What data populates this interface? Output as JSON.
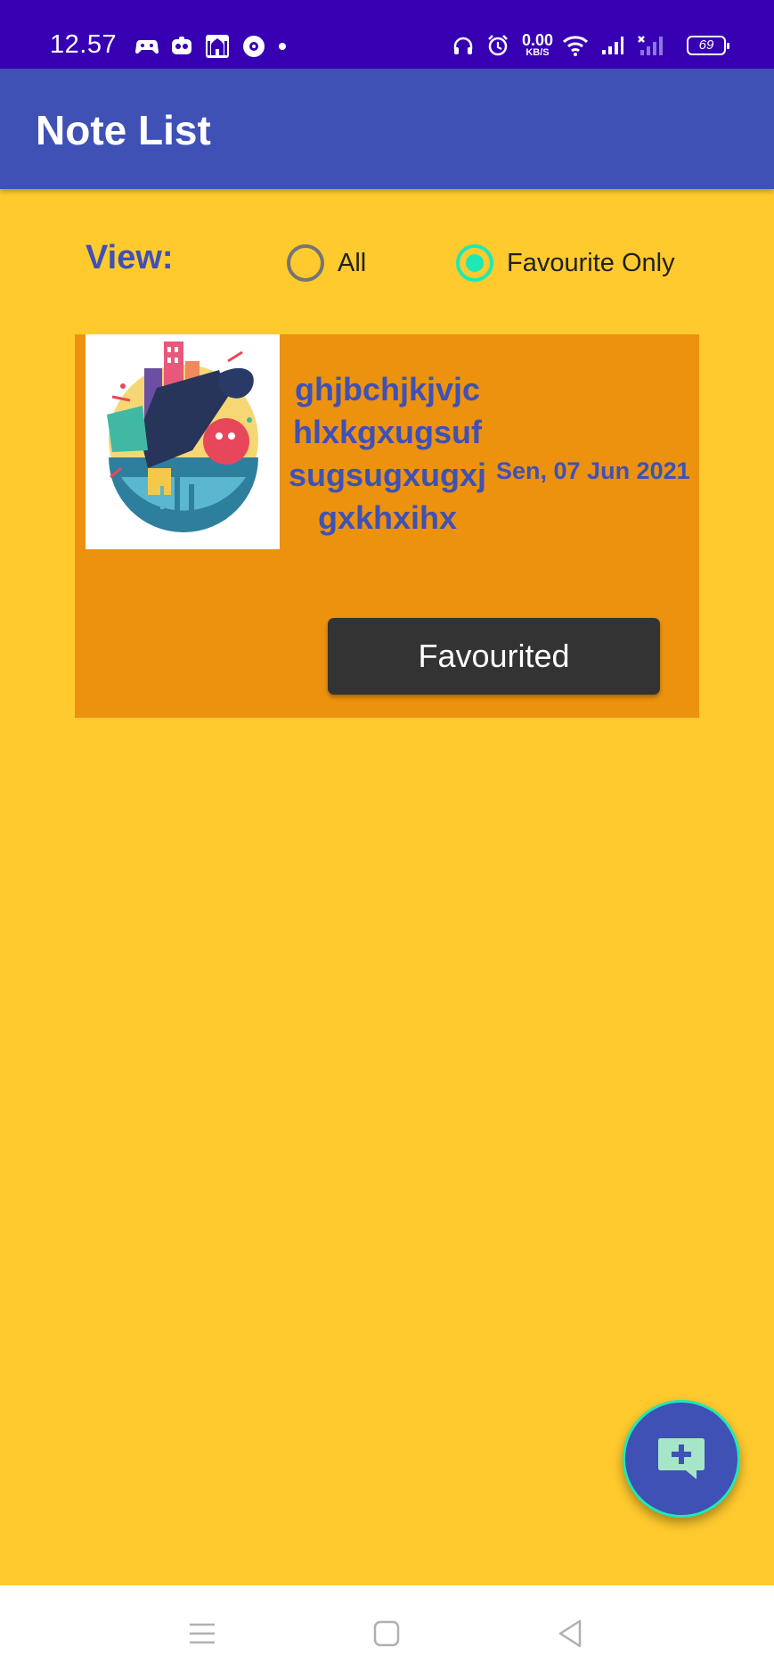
{
  "status_bar": {
    "time": "12.57",
    "net_speed_value": "0.00",
    "net_speed_unit": "KB/S",
    "battery": "69",
    "left_icons": [
      "game-controller-icon",
      "social-app-icon",
      "mosque-app-icon",
      "location-app-icon",
      "notification-dot-icon"
    ],
    "right_icons": [
      "headset-icon",
      "alarm-icon",
      "wifi-icon",
      "signal-icon",
      "signal-no-service-icon",
      "battery-icon"
    ]
  },
  "app_bar": {
    "title": "Note List"
  },
  "filter": {
    "label": "View:",
    "options": [
      {
        "label": "All",
        "checked": false
      },
      {
        "label": "Favourite Only",
        "checked": true
      }
    ]
  },
  "notes": [
    {
      "title": "ghjbchjkjvjchlxkgxugsufsugsugxugxjgxkhxihx",
      "date": "Sen, 07 Jun 2021",
      "button_label": "Favourited",
      "image": "abstract-city-illustration"
    }
  ],
  "fab": {
    "icon": "add-comment-icon"
  },
  "nav_bar": {
    "icons": [
      "menu-icon",
      "home-icon",
      "back-icon"
    ]
  },
  "colors": {
    "status_bar": "#3700B3",
    "primary": "#3F51B5",
    "background": "#FFCA2E",
    "card": "#EC920F",
    "accent": "#1DE9B6",
    "button": "#333333"
  }
}
